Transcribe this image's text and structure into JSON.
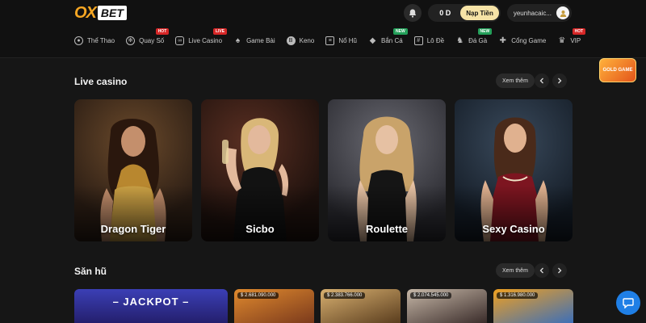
{
  "header": {
    "logo_ox": "OX",
    "logo_bet": "BET",
    "balance": "0 D",
    "deposit_label": "Nạp Tiền",
    "username": "yeunhacaic..."
  },
  "nav": {
    "items": [
      {
        "label": "Thể Thao",
        "icon": "soccer-ball-icon",
        "badge": ""
      },
      {
        "label": "Quay Số",
        "icon": "lottery-icon",
        "badge": "HOT"
      },
      {
        "label": "Live Casino",
        "icon": "mask-icon",
        "badge": "LIVE"
      },
      {
        "label": "Game Bài",
        "icon": "spade-icon",
        "badge": ""
      },
      {
        "label": "Keno",
        "icon": "keno-icon",
        "badge": ""
      },
      {
        "label": "Nổ Hũ",
        "icon": "slot-machine-icon",
        "badge": ""
      },
      {
        "label": "Bắn Cá",
        "icon": "fish-icon",
        "badge": "NEW"
      },
      {
        "label": "Lô Đề",
        "icon": "lotto-icon",
        "badge": ""
      },
      {
        "label": "Đá Gà",
        "icon": "rooster-icon",
        "badge": "NEW"
      },
      {
        "label": "Cổng Game",
        "icon": "gamepad-icon",
        "badge": ""
      },
      {
        "label": "VIP",
        "icon": "crown-icon",
        "badge": "HOT"
      }
    ]
  },
  "live_casino": {
    "title": "Live casino",
    "see_more": "Xem thêm",
    "games": [
      {
        "name": "Dragon Tiger"
      },
      {
        "name": "Sicbo"
      },
      {
        "name": "Roulette"
      },
      {
        "name": "Sexy Casino"
      }
    ]
  },
  "slots": {
    "title": "Săn hũ",
    "see_more": "Xem thêm",
    "jackpot_label": "– JACKPOT –",
    "amounts": [
      "$ 2.681.090.000",
      "$ 2.383.766.000",
      "$ 2.074.545.000",
      "$ 1.316.980.000"
    ]
  },
  "promo": {
    "label": "GOLD GAME"
  },
  "colors": {
    "accent": "#f5a623",
    "deposit_bg": "#f6e3a6",
    "hot_badge": "#d62727",
    "new_badge": "#24a05a",
    "chat": "#1f7fe6"
  }
}
